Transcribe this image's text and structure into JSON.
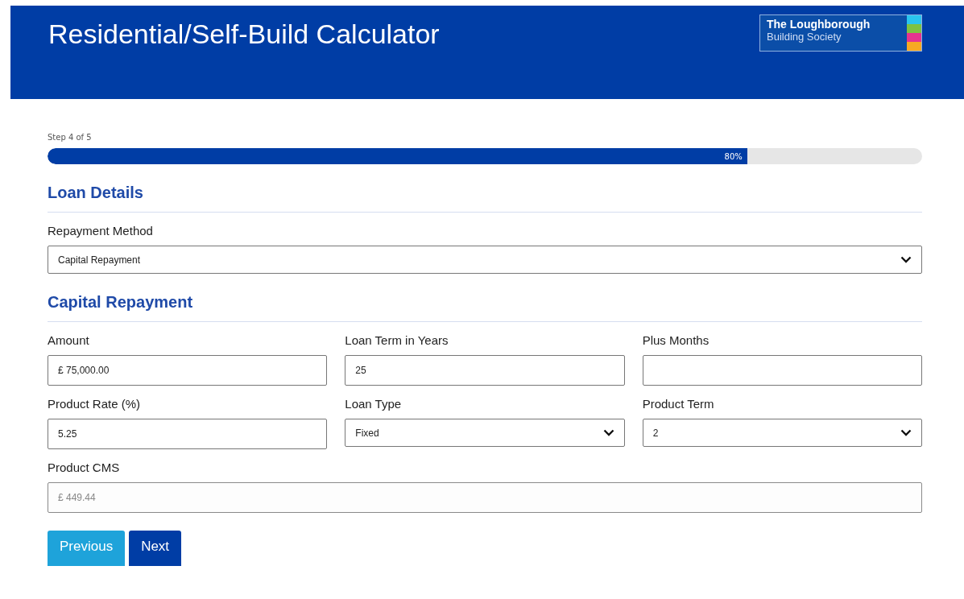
{
  "header": {
    "title": "Residential/Self-Build Calculator",
    "logo": {
      "line_1": "The Loughborough",
      "line_2": "Building Society"
    }
  },
  "progress": {
    "step": "Step 4 of 5",
    "level": 0.8,
    "reading": "80%"
  },
  "sections": [
    {
      "title": "Loan Details",
      "rows": [
        [
          {
            "kind": "select",
            "label": "Repayment Method",
            "value": "Capital Repayment"
          }
        ]
      ]
    },
    {
      "title": "Capital Repayment",
      "rows": [
        [
          {
            "kind": "input",
            "label": "Amount",
            "value": "£ 75,000.00",
            "disabled": false
          },
          {
            "kind": "input",
            "label": "Loan Term in Years",
            "value": "25",
            "disabled": false
          },
          {
            "kind": "input",
            "label": "Plus Months",
            "disabled": false
          }
        ],
        [
          {
            "kind": "input",
            "label": "Product Rate (%)",
            "value": "5.25",
            "disabled": false
          },
          {
            "kind": "select",
            "label": "Loan Type",
            "value": "Fixed"
          },
          {
            "kind": "select",
            "label": "Product Term",
            "value": "2"
          }
        ],
        [
          {
            "kind": "input",
            "label": "Product CMS",
            "value": "£ 449.44",
            "disabled": true
          }
        ]
      ]
    }
  ],
  "buttons": [
    {
      "label": "Previous",
      "kind": "secondary"
    },
    {
      "label": "Next",
      "kind": "primary"
    }
  ]
}
